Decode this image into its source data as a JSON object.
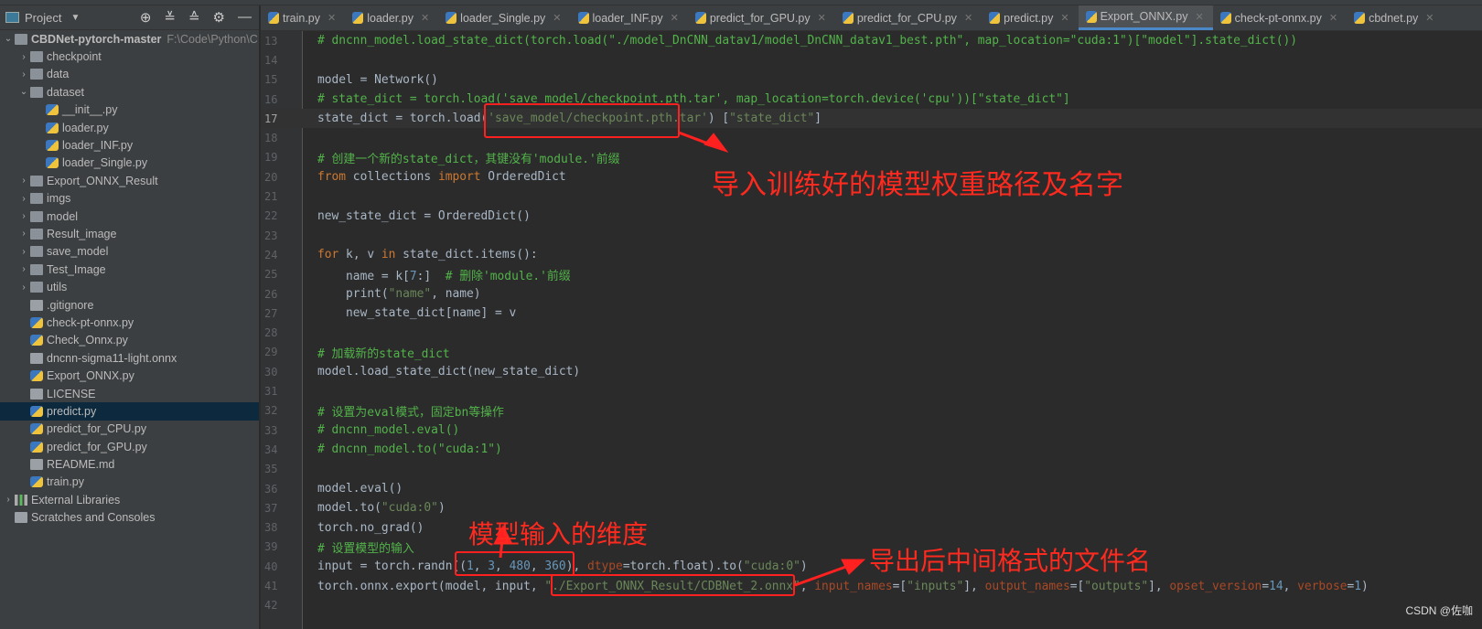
{
  "sidebar": {
    "title": "Project",
    "tools": [
      "locate-icon",
      "expand-all-icon",
      "collapse-all-icon",
      "gear-icon",
      "minimize-icon"
    ],
    "items": [
      {
        "label": "CBDNet-pytorch-master",
        "path": "F:\\Code\\Python\\C",
        "depth": 0,
        "type": "folder",
        "arrow": "v",
        "bold": true
      },
      {
        "label": "checkpoint",
        "depth": 1,
        "type": "folder",
        "arrow": ">"
      },
      {
        "label": "data",
        "depth": 1,
        "type": "folder",
        "arrow": ">"
      },
      {
        "label": "dataset",
        "depth": 1,
        "type": "folder",
        "arrow": "v"
      },
      {
        "label": "__init__.py",
        "depth": 2,
        "type": "py"
      },
      {
        "label": "loader.py",
        "depth": 2,
        "type": "py"
      },
      {
        "label": "loader_INF.py",
        "depth": 2,
        "type": "py"
      },
      {
        "label": "loader_Single.py",
        "depth": 2,
        "type": "py"
      },
      {
        "label": "Export_ONNX_Result",
        "depth": 1,
        "type": "folder",
        "arrow": ">"
      },
      {
        "label": "imgs",
        "depth": 1,
        "type": "folder",
        "arrow": ">"
      },
      {
        "label": "model",
        "depth": 1,
        "type": "folder",
        "arrow": ">"
      },
      {
        "label": "Result_image",
        "depth": 1,
        "type": "folder",
        "arrow": ">"
      },
      {
        "label": "save_model",
        "depth": 1,
        "type": "folder",
        "arrow": ">"
      },
      {
        "label": "Test_Image",
        "depth": 1,
        "type": "folder",
        "arrow": ">"
      },
      {
        "label": "utils",
        "depth": 1,
        "type": "folder",
        "arrow": ">"
      },
      {
        "label": ".gitignore",
        "depth": 1,
        "type": "file"
      },
      {
        "label": "check-pt-onnx.py",
        "depth": 1,
        "type": "py"
      },
      {
        "label": "Check_Onnx.py",
        "depth": 1,
        "type": "py"
      },
      {
        "label": "dncnn-sigma11-light.onnx",
        "depth": 1,
        "type": "file"
      },
      {
        "label": "Export_ONNX.py",
        "depth": 1,
        "type": "py"
      },
      {
        "label": "LICENSE",
        "depth": 1,
        "type": "file"
      },
      {
        "label": "predict.py",
        "depth": 1,
        "type": "py",
        "selected": true
      },
      {
        "label": "predict_for_CPU.py",
        "depth": 1,
        "type": "py"
      },
      {
        "label": "predict_for_GPU.py",
        "depth": 1,
        "type": "py"
      },
      {
        "label": "README.md",
        "depth": 1,
        "type": "file"
      },
      {
        "label": "train.py",
        "depth": 1,
        "type": "py"
      },
      {
        "label": "External Libraries",
        "depth": 0,
        "type": "lib",
        "arrow": ">"
      },
      {
        "label": "Scratches and Consoles",
        "depth": 0,
        "type": "file"
      }
    ]
  },
  "tabs": [
    {
      "label": "train.py"
    },
    {
      "label": "loader.py"
    },
    {
      "label": "loader_Single.py"
    },
    {
      "label": "loader_INF.py"
    },
    {
      "label": "predict_for_GPU.py"
    },
    {
      "label": "predict_for_CPU.py"
    },
    {
      "label": "predict.py"
    },
    {
      "label": "Export_ONNX.py",
      "active": true
    },
    {
      "label": "check-pt-onnx.py"
    },
    {
      "label": "cbdnet.py"
    }
  ],
  "editor": {
    "current_line": 17,
    "lines": [
      {
        "n": 13,
        "t": [
          [
            "# dncnn_model.load_state_dict(torch.load(\"./model_DnCNN_datav1/model_DnCNN_datav1_best.pth\", map_location=\"cuda:1\")[\"model\"].state_dict())",
            "c"
          ]
        ]
      },
      {
        "n": 14,
        "t": []
      },
      {
        "n": 15,
        "t": [
          [
            "model = Network()",
            "d"
          ]
        ]
      },
      {
        "n": 16,
        "t": [
          [
            "# state_dict = torch.load('save_model/checkpoint.pth.tar', map_location=torch.device('cpu'))[\"state_dict\"]",
            "c"
          ]
        ]
      },
      {
        "n": 17,
        "t": [
          [
            "state_dict = torch.load(",
            "d"
          ],
          [
            "'save_model/checkpoint.pth.tar'",
            "s"
          ],
          [
            ") ",
            "d"
          ],
          [
            "[",
            "d"
          ],
          [
            "\"state_dict\"",
            "s"
          ],
          [
            "]",
            "d"
          ]
        ]
      },
      {
        "n": 18,
        "t": []
      },
      {
        "n": 19,
        "t": [
          [
            "# 创建一个新的state_dict，其键没有'module.'前缀",
            "c"
          ]
        ]
      },
      {
        "n": 20,
        "t": [
          [
            "from",
            "k"
          ],
          [
            " collections ",
            "d"
          ],
          [
            "import",
            "k"
          ],
          [
            " OrderedDict",
            "d"
          ]
        ]
      },
      {
        "n": 21,
        "t": []
      },
      {
        "n": 22,
        "t": [
          [
            "new_state_dict = OrderedDict()",
            "d"
          ]
        ]
      },
      {
        "n": 23,
        "t": []
      },
      {
        "n": 24,
        "t": [
          [
            "for",
            "k"
          ],
          [
            " k, v ",
            "d"
          ],
          [
            "in",
            "k"
          ],
          [
            " state_dict.items():",
            "d"
          ]
        ]
      },
      {
        "n": 25,
        "t": [
          [
            "    name = k[",
            "d"
          ],
          [
            "7",
            "n"
          ],
          [
            ":]  ",
            "d"
          ],
          [
            "# 删除'module.'前缀",
            "c"
          ]
        ]
      },
      {
        "n": 26,
        "t": [
          [
            "    print(",
            "d"
          ],
          [
            "\"name\"",
            "s"
          ],
          [
            ", name)",
            "d"
          ]
        ]
      },
      {
        "n": 27,
        "t": [
          [
            "    new_state_dict[name] = v",
            "d"
          ]
        ]
      },
      {
        "n": 28,
        "t": []
      },
      {
        "n": 29,
        "t": [
          [
            "# 加载新的state_dict",
            "c"
          ]
        ]
      },
      {
        "n": 30,
        "t": [
          [
            "model.load_state_dict(new_state_dict)",
            "d"
          ]
        ]
      },
      {
        "n": 31,
        "t": []
      },
      {
        "n": 32,
        "t": [
          [
            "# 设置为eval模式，固定bn等操作",
            "c"
          ]
        ]
      },
      {
        "n": 33,
        "t": [
          [
            "# dncnn_model.eval()",
            "c"
          ]
        ]
      },
      {
        "n": 34,
        "t": [
          [
            "# dncnn_model.to(\"cuda:1\")",
            "c"
          ]
        ]
      },
      {
        "n": 35,
        "t": []
      },
      {
        "n": 36,
        "t": [
          [
            "model.eval()",
            "d"
          ]
        ]
      },
      {
        "n": 37,
        "t": [
          [
            "model.to(",
            "d"
          ],
          [
            "\"cuda:0\"",
            "s"
          ],
          [
            ")",
            "d"
          ]
        ]
      },
      {
        "n": 38,
        "t": [
          [
            "torch.no_grad()",
            "d"
          ]
        ]
      },
      {
        "n": 39,
        "t": [
          [
            "# 设置模型的输入",
            "c"
          ]
        ]
      },
      {
        "n": 40,
        "t": [
          [
            "input = torch.randn((",
            "d"
          ],
          [
            "1",
            "n"
          ],
          [
            ", ",
            "d"
          ],
          [
            "3",
            "n"
          ],
          [
            ", ",
            "d"
          ],
          [
            "480",
            "n"
          ],
          [
            ", ",
            "d"
          ],
          [
            "360",
            "n"
          ],
          [
            "), ",
            "d"
          ],
          [
            "dtype",
            "p"
          ],
          [
            "=torch.float).to(",
            "d"
          ],
          [
            "\"cuda:0\"",
            "s"
          ],
          [
            ")",
            "d"
          ]
        ]
      },
      {
        "n": 41,
        "t": [
          [
            "torch.onnx.export(model, input, ",
            "d"
          ],
          [
            "\"./Export_ONNX_Result/CDBNet_2.onnx\"",
            "s"
          ],
          [
            ", ",
            "d"
          ],
          [
            "input_names",
            "p"
          ],
          [
            "=[",
            "d"
          ],
          [
            "\"inputs\"",
            "s"
          ],
          [
            "], ",
            "d"
          ],
          [
            "output_names",
            "p"
          ],
          [
            "=[",
            "d"
          ],
          [
            "\"outputs\"",
            "s"
          ],
          [
            "], ",
            "d"
          ],
          [
            "opset_version",
            "p"
          ],
          [
            "=",
            "d"
          ],
          [
            "14",
            "n"
          ],
          [
            ", ",
            "d"
          ],
          [
            "verbose",
            "p"
          ],
          [
            "=",
            "d"
          ],
          [
            "1",
            "n"
          ],
          [
            ")",
            "d"
          ]
        ]
      },
      {
        "n": 42,
        "t": []
      }
    ]
  },
  "annotations": {
    "weights_path": "导入训练好的模型权重路径及名字",
    "input_dims": "模型输入的维度",
    "output_file": "导出后中间格式的文件名",
    "color": "#ff2020"
  },
  "watermark": "CSDN @佐咖"
}
